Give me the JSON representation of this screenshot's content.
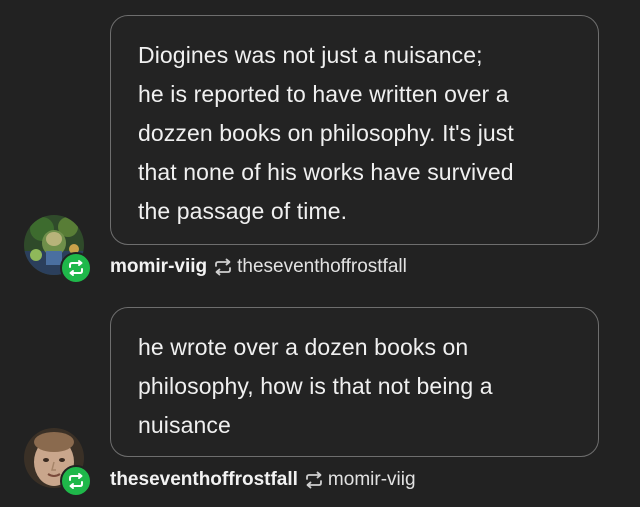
{
  "posts": [
    {
      "text_lines": [
        "Diogines was not just a nuisance;",
        "he is reported to have written over a",
        "dozzen books on philosophy. It's just",
        "that none of his works have survived",
        "the passage of time."
      ],
      "username": "momir-viig",
      "reblogged_from": "theseventhoffrostfall"
    },
    {
      "text_lines": [
        "he wrote over a dozen books on",
        "philosophy, how is that not being a",
        "nuisance"
      ],
      "username": "theseventhoffrostfall",
      "reblogged_from": "momir-viig"
    }
  ],
  "colors": {
    "background": "#222222",
    "bubble_border": "#6e6e6e",
    "reblog_badge": "#1fb84a",
    "text": "#f0f0f0"
  },
  "icons": {
    "reblog_badge": "reblog-icon",
    "reblog_inline": "reblog-icon"
  }
}
